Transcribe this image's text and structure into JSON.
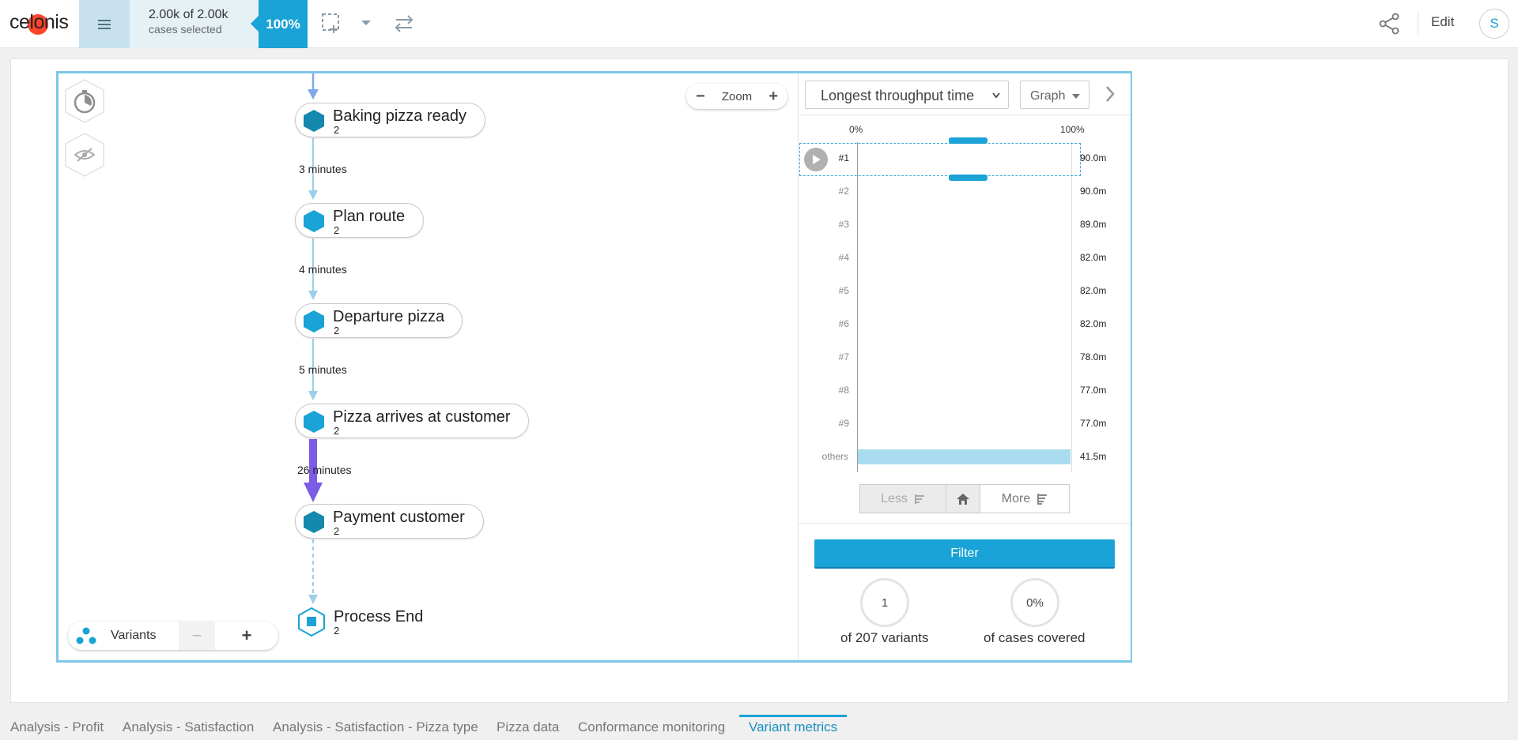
{
  "header": {
    "logo_text": "celonis",
    "cases_count": "2.00k of 2.00k",
    "cases_subtitle": "cases selected",
    "selection_pct": "100%",
    "edit_label": "Edit",
    "avatar_initial": "S"
  },
  "graph": {
    "zoom_label": "Zoom",
    "zoom_minus": "−",
    "zoom_plus": "+",
    "nodes": [
      {
        "label": "Baking pizza ready",
        "count": "2"
      },
      {
        "label": "Plan route",
        "count": "2"
      },
      {
        "label": "Departure pizza",
        "count": "2"
      },
      {
        "label": "Pizza arrives at customer",
        "count": "2"
      },
      {
        "label": "Payment customer",
        "count": "2"
      },
      {
        "label": "Process End",
        "count": "2"
      }
    ],
    "edges": [
      "3 minutes",
      "4 minutes",
      "5 minutes",
      "26 minutes"
    ],
    "variants_label": "Variants",
    "variants_minus": "−",
    "variants_plus": "+"
  },
  "variant_panel": {
    "sort_by": "Longest throughput time",
    "view_mode": "Graph",
    "axis_min": "0%",
    "axis_max": "100%",
    "rows": [
      {
        "label": "#1",
        "value": "90.0m"
      },
      {
        "label": "#2",
        "value": "90.0m"
      },
      {
        "label": "#3",
        "value": "89.0m"
      },
      {
        "label": "#4",
        "value": "82.0m"
      },
      {
        "label": "#5",
        "value": "82.0m"
      },
      {
        "label": "#6",
        "value": "82.0m"
      },
      {
        "label": "#7",
        "value": "78.0m"
      },
      {
        "label": "#8",
        "value": "77.0m"
      },
      {
        "label": "#9",
        "value": "77.0m"
      },
      {
        "label": "others",
        "value": "41.5m"
      }
    ],
    "less_label": "Less",
    "more_label": "More",
    "filter_label": "Filter",
    "variants_selected": "1",
    "variants_caption": "of 207 variants",
    "cases_covered": "0%",
    "cases_caption": "of cases covered"
  },
  "tabs": [
    {
      "label": "Analysis - Profit"
    },
    {
      "label": "Analysis - Satisfaction"
    },
    {
      "label": "Analysis - Satisfaction - Pizza type"
    },
    {
      "label": "Pizza data"
    },
    {
      "label": "Conformance monitoring"
    },
    {
      "label": "Variant metrics",
      "active": true
    }
  ],
  "colors": {
    "accent": "#1aa3d6",
    "node_hex": "#1aa3d6",
    "node_hex_dark": "#1488ad",
    "edge": "#9ccfe9",
    "edge_highlight": "#7a5ce6"
  }
}
